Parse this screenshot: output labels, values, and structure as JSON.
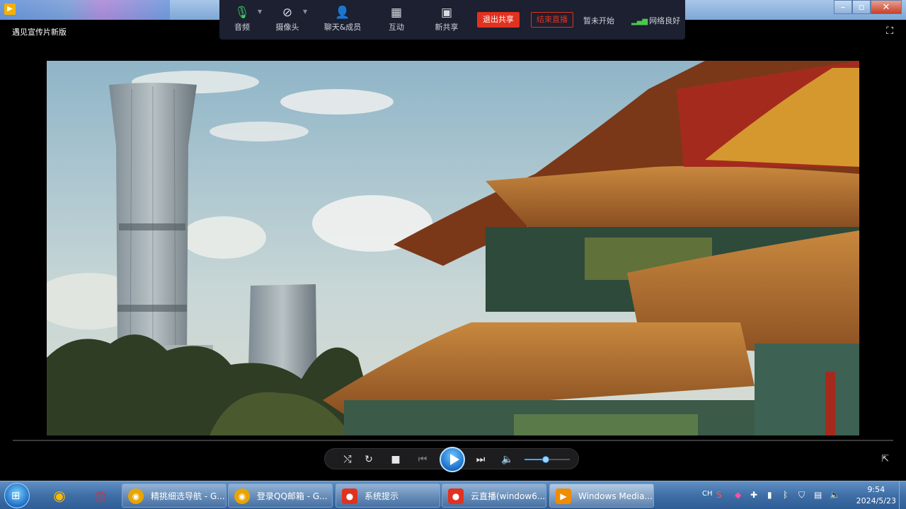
{
  "window": {
    "title": "遇见宣传片新版"
  },
  "share_toolbar": {
    "items": [
      {
        "label": "音频",
        "icon": "microphone-icon"
      },
      {
        "label": "摄像头",
        "icon": "camera-off-icon"
      },
      {
        "label": "聊天&成员",
        "icon": "person-icon"
      },
      {
        "label": "互动",
        "icon": "grid-icon"
      },
      {
        "label": "新共享",
        "icon": "screen-share-icon"
      }
    ],
    "exit_share": "退出共享",
    "end_live": "结束直播",
    "status": "暂未开始",
    "network": "网络良好"
  },
  "player": {
    "volume_fraction": 0.47,
    "state": "paused"
  },
  "taskbar": {
    "tasks": [
      {
        "label": "精挑细选导航 - G..."
      },
      {
        "label": "登录QQ邮箱 - G..."
      },
      {
        "label": "系统提示"
      },
      {
        "label": "云直播(window6..."
      },
      {
        "label": "Windows Media..."
      }
    ],
    "tray_lang": "CH",
    "clock_time": "9:54",
    "clock_date": "2024/5/23"
  },
  "colors": {
    "accent_red": "#e0321f",
    "toolbar_bg": "#1c2030",
    "taskbar": "#3f6fa6"
  }
}
